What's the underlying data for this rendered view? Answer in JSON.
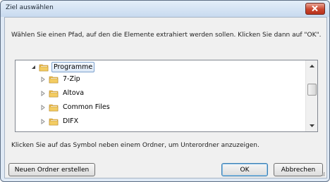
{
  "window": {
    "title": "Ziel auswählen",
    "close_icon": "close-icon"
  },
  "instruction": "Wählen Sie einen Pfad, auf den die Elemente extrahiert werden sollen. Klicken Sie dann auf \"OK\".",
  "tree": {
    "items": [
      {
        "label": "Programme",
        "expanded": true,
        "selected": true
      },
      {
        "label": "7-Zip",
        "expanded": false
      },
      {
        "label": "Altova",
        "expanded": false
      },
      {
        "label": "Common Files",
        "expanded": false
      },
      {
        "label": "DIFX",
        "expanded": false
      }
    ]
  },
  "hint": "Klicken Sie auf das Symbol neben einem Ordner, um Unterordner anzuzeigen.",
  "buttons": {
    "new_folder": "Neuen Ordner erstellen",
    "ok": "OK",
    "cancel": "Abbrechen"
  },
  "colors": {
    "folder": "#e8b84a",
    "selection_border": "#7da2ce",
    "close_button": "#c9452e"
  }
}
